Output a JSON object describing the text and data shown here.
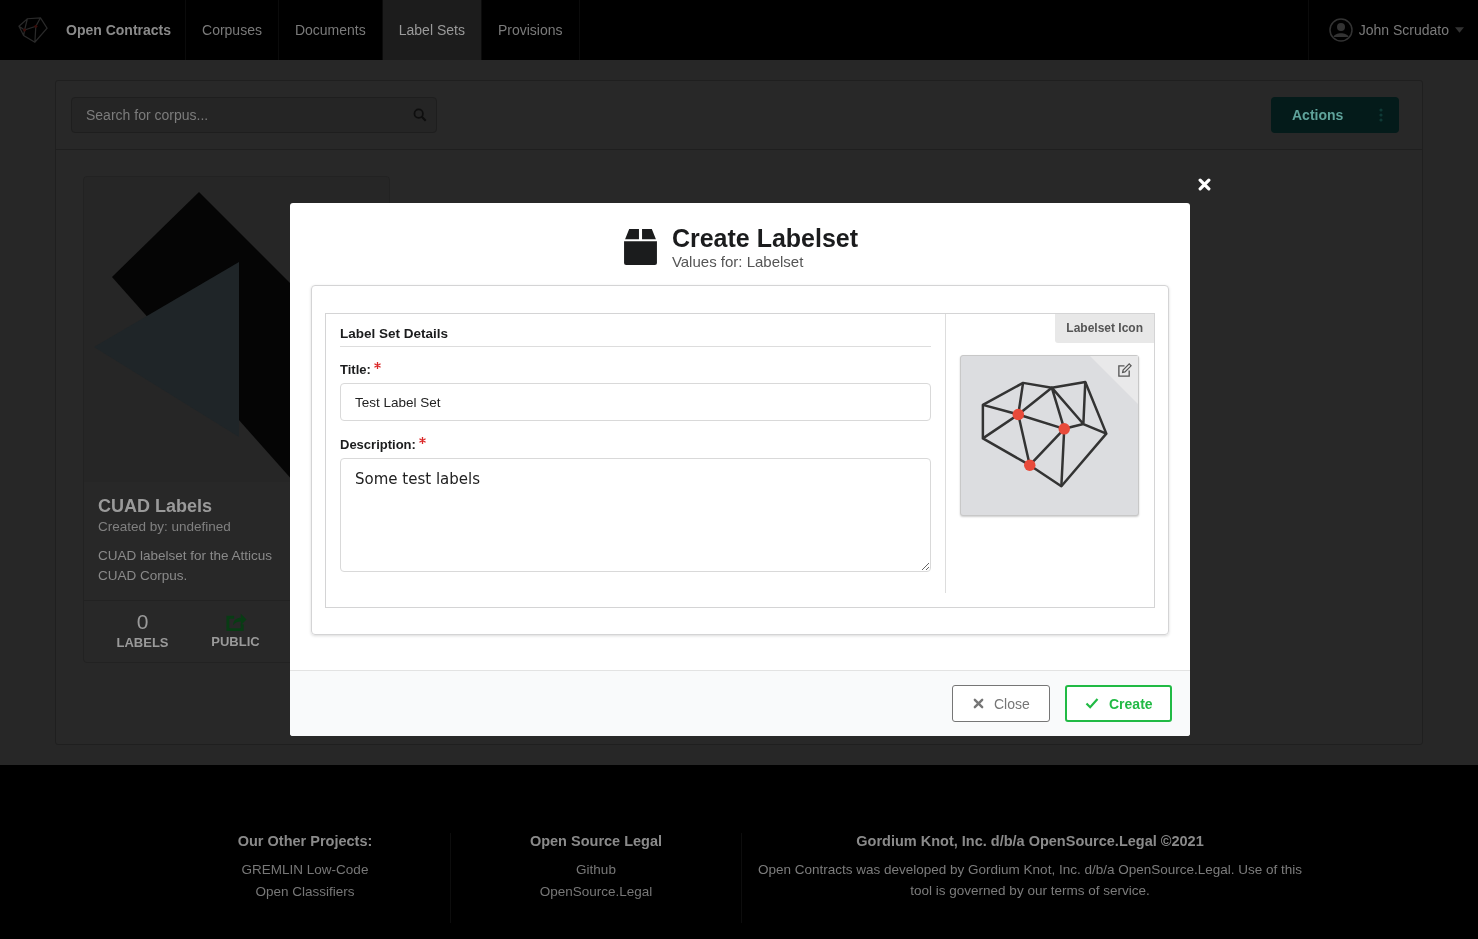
{
  "navbar": {
    "brand": "Open Contracts",
    "items": [
      {
        "label": "Corpuses",
        "selected": false
      },
      {
        "label": "Documents",
        "selected": false
      },
      {
        "label": "Label Sets",
        "selected": true
      },
      {
        "label": "Provisions",
        "selected": false
      }
    ],
    "user": "John Scrudato"
  },
  "toolbar": {
    "search": {
      "placeholder": "Search for corpus..."
    },
    "actions": "Actions"
  },
  "card": {
    "title": "CUAD Labels",
    "created_by": "Created by: undefined",
    "description_lines": [
      "CUAD labelset for the Atticus",
      "CUAD Corpus."
    ],
    "stats": [
      {
        "kind": "count",
        "value": "0",
        "label": "LABELS"
      },
      {
        "kind": "icon",
        "label": "PUBLIC"
      }
    ]
  },
  "modal": {
    "title": "Create Labelset",
    "subtitle": "Values for: Labelset",
    "section_title": "Label Set Details",
    "fields": [
      {
        "kind": "input",
        "label": "Title:",
        "required": true,
        "value": "Test Label Set"
      },
      {
        "kind": "textarea",
        "label": "Description:",
        "required": true,
        "value": "Some test labels"
      }
    ],
    "icon_label": "Labelset Icon",
    "buttons": [
      {
        "kind": "close",
        "label": "Close"
      },
      {
        "kind": "create",
        "label": "Create"
      }
    ]
  },
  "footer": {
    "columns": [
      {
        "heading": "Our Other Projects:",
        "links": [
          "GREMLIN Low-Code",
          "Open Classifiers"
        ]
      },
      {
        "heading": "Open Source Legal",
        "links": [
          "Github",
          "OpenSource.Legal"
        ]
      },
      {
        "heading": "Gordium Knot, Inc. d/b/a OpenSource.Legal ©2021",
        "text": "Open Contracts was developed by Gordium Knot, Inc. d/b/a OpenSource.Legal. Use of this tool is governed by our terms of service."
      }
    ]
  }
}
